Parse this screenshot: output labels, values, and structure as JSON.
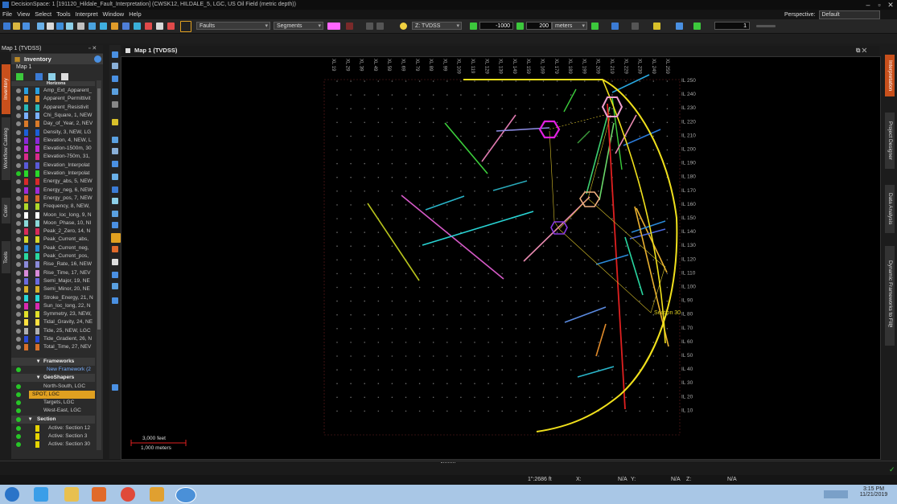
{
  "window": {
    "title": "DecisionSpace: 1 [191120_Hildale_Fault_Interpretation] (CWSK12, HILDALE_5, LGC, US Oil Field (metric depth))"
  },
  "menu": [
    "File",
    "View",
    "Select",
    "Tools",
    "Interpret",
    "Window",
    "Help"
  ],
  "perspective": {
    "label": "Perspective:",
    "value": "Default"
  },
  "toolbar": {
    "faults_combo": "Faults",
    "segments_combo": "Segments",
    "domain_combo": "Z: TVDSS",
    "depth_value": "-1000",
    "step_value": "200",
    "step_unit": "meters",
    "count_value": "1"
  },
  "inventory": {
    "panel_title": "Map 1 (TVDSS)",
    "header": "Inventory",
    "map_name": "Map 1",
    "horizons_header": "Horizons",
    "horizons": [
      {
        "label": "Amp_Ext_Apparent_",
        "color": "#2aa0e0"
      },
      {
        "label": "Apparent_Permittivit",
        "color": "#e08a2a"
      },
      {
        "label": "Apparent_Resistivit",
        "color": "#2ab9b9"
      },
      {
        "label": "Chi_Square, 1, NEW",
        "color": "#7ab0ff"
      },
      {
        "label": "Day_of_Year, 2, NEV",
        "color": "#d87a2a"
      },
      {
        "label": "Density, 3, NEW, LG",
        "color": "#1b5fd8"
      },
      {
        "label": "Elevation, 4, NEW, L",
        "color": "#8a2ad8"
      },
      {
        "label": "Elevation-1500m, 30",
        "color": "#c02ad8"
      },
      {
        "label": "Elevation-750m, 31,",
        "color": "#d82a8a"
      },
      {
        "label": "Elevation_Interpolat",
        "color": "#5a5ad8"
      },
      {
        "label": "Elevation_Interpolat",
        "color": "#2ad82a"
      },
      {
        "label": "Energy_abs, 5, NEW",
        "color": "#d82a2a"
      },
      {
        "label": "Energy_neg, 6, NEW",
        "color": "#a02ad8"
      },
      {
        "label": "Energy_pos, 7, NEW",
        "color": "#d86a2a"
      },
      {
        "label": "Frequency, 8, NEW,",
        "color": "#b0d82a"
      },
      {
        "label": "Moon_loc_long, 9, N",
        "color": "#ffffff"
      },
      {
        "label": "Moon_Phase, 10, NI",
        "color": "#8ad8d8"
      },
      {
        "label": "Peak_2_Zero, 14, N",
        "color": "#d82a5a"
      },
      {
        "label": "Peak_Current_abs,",
        "color": "#d8d82a"
      },
      {
        "label": "Peak_Current_neg,",
        "color": "#2a8ad8"
      },
      {
        "label": "Peak_Current_pos,",
        "color": "#2ad8a0"
      },
      {
        "label": "Rise_Rate, 16, NEW",
        "color": "#8a8ad8"
      },
      {
        "label": "Rise_Time, 17, NEV",
        "color": "#d88ad8"
      },
      {
        "label": "Semi_Major, 19, NE",
        "color": "#6a6ae0"
      },
      {
        "label": "Semi_Minor, 20, NE",
        "color": "#d8b02a"
      },
      {
        "label": "Stroke_Energy, 21, N",
        "color": "#2ad8d8"
      },
      {
        "label": "Sun_loc_long, 22, N",
        "color": "#d82ab0"
      },
      {
        "label": "Symmetry, 23, NEW,",
        "color": "#e0e02a"
      },
      {
        "label": "Tidal_Gravity, 24, NE",
        "color": "#ffe040"
      },
      {
        "label": "Tide, 25, NEW, LGC",
        "color": "#b0b0b0"
      },
      {
        "label": "Tide_Gradient, 26, N",
        "color": "#2a4ad8"
      },
      {
        "label": "Total_Time, 27, NEV",
        "color": "#d8702a"
      }
    ],
    "frameworks_header": "Frameworks",
    "frameworks": [
      "New Framework (2"
    ],
    "geoshapers_header": "GeoShapers",
    "geoshapers": [
      "North-South, LGC",
      "SPOT, LGC",
      "Targets, LGC",
      "West-East, LGC"
    ],
    "section_header": "Section",
    "sections": [
      "Active: Section 12",
      "Active: Section 3",
      "Active: Section 30"
    ]
  },
  "left_tabs": [
    "Inventory",
    "Workflow Catalog",
    "Color",
    "Tools"
  ],
  "right_tabs": [
    "Interpretation",
    "Project Designer",
    "Data Analysis",
    "Dynamic Frameworks to Fill™"
  ],
  "map": {
    "title": "Map 1 (TVDSS)",
    "xl_labels": [
      "XL 19",
      "XL 29",
      "XL 39",
      "XL 49",
      "XL 59",
      "XL 69",
      "XL 79",
      "XL 89",
      "XL 99",
      "XL 109",
      "XL 119",
      "XL 129",
      "XL 139",
      "XL 149",
      "XL 159",
      "XL 169",
      "XL 179",
      "XL 189",
      "XL 199",
      "XL 209",
      "XL 219",
      "XL 229",
      "XL 239",
      "XL 249",
      "XL 259"
    ],
    "il_labels": [
      "IL 250",
      "IL 240",
      "IL 230",
      "IL 220",
      "IL 210",
      "IL 200",
      "IL 190",
      "IL 180",
      "IL 170",
      "IL 160",
      "IL 150",
      "IL 140",
      "IL 130",
      "IL 120",
      "IL 110",
      "IL 100",
      "IL 90",
      "IL 80",
      "IL 70",
      "IL 60",
      "IL 50",
      "IL 40",
      "IL 30",
      "IL 20",
      "IL 10"
    ],
    "section_label": "Section 30",
    "scalebar": {
      "top": "3,000 feet",
      "bottom": "1,000 meters"
    }
  },
  "status": {
    "scale": "1\":2686 ft",
    "x_label": "X:",
    "x_value": "N/A",
    "y_label": "Y:",
    "y_value": "N/A",
    "z_label": "Z:",
    "z_value": "N/A"
  },
  "taskbar": {
    "time": "3:15 PM",
    "date": "11/21/2019"
  }
}
